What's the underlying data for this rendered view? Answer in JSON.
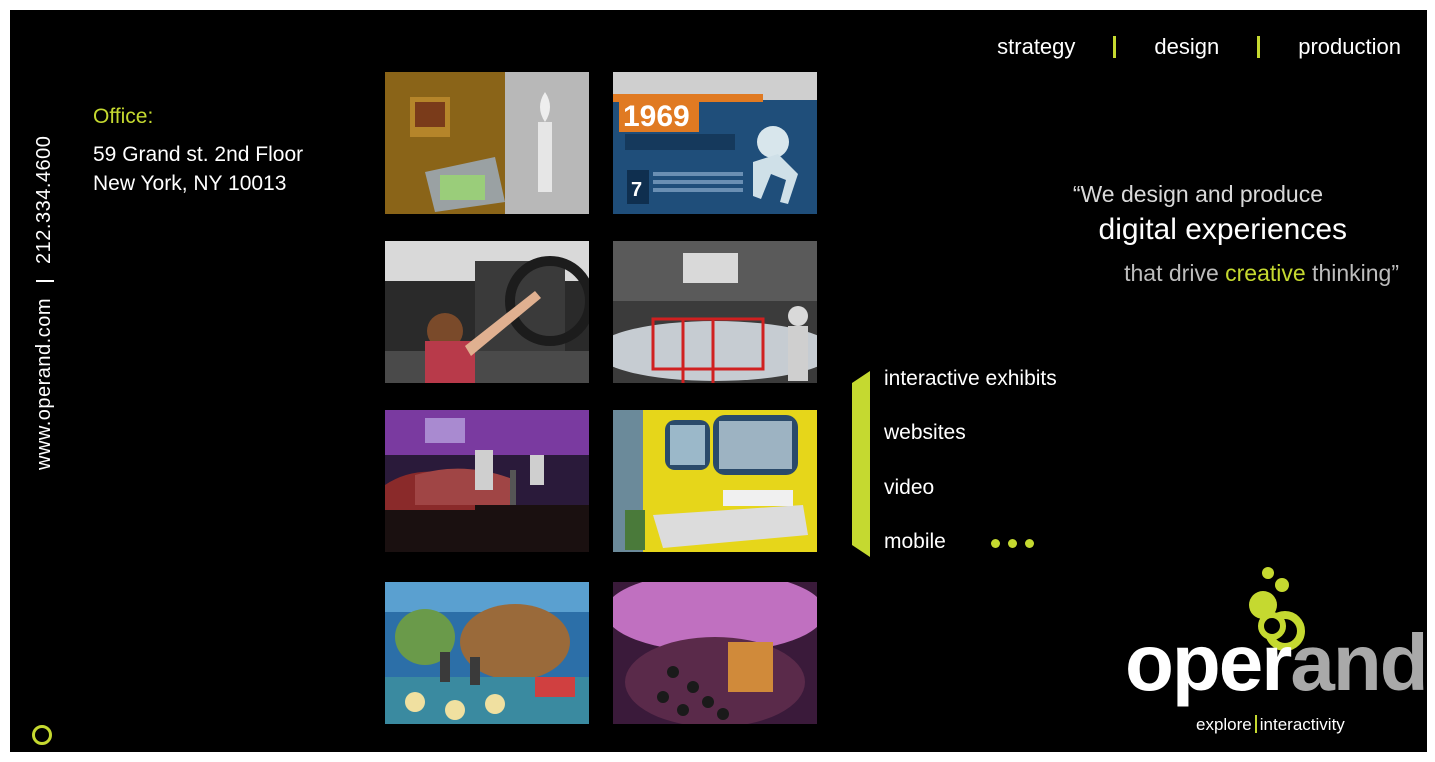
{
  "contact": {
    "website": "www.operand.com",
    "phone": "212.334.4600"
  },
  "office": {
    "label": "Office:",
    "line1": "59 Grand st. 2nd Floor",
    "line2": "New York, NY 10013"
  },
  "nav": {
    "items": [
      "strategy",
      "design",
      "production"
    ]
  },
  "tagline": {
    "line1": "“We design and produce",
    "line2": "digital experiences",
    "line3_before": "that drive ",
    "line3_highlight": "creative",
    "line3_after": " thinking”"
  },
  "services": {
    "items": [
      "interactive exhibits",
      "websites",
      "video",
      "mobile"
    ]
  },
  "gallery": {
    "year_banner": "1969",
    "date_number": "7"
  },
  "logo": {
    "word_white": "oper",
    "word_gray": "and",
    "tag_left": "explore",
    "tag_right": "interactivity"
  },
  "colors": {
    "accent": "#c5d930",
    "background": "#000000",
    "text": "#ffffff"
  }
}
